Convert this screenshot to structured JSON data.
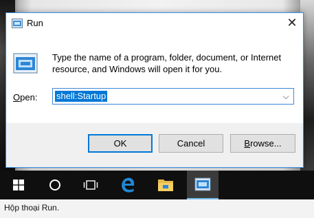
{
  "window": {
    "title": "Run",
    "close_symbol": "✕"
  },
  "dialog": {
    "description": "Type the name of a program, folder, document, or Internet resource, and Windows will open it for you.",
    "open_label_accel": "O",
    "open_label_rest": "pen:",
    "input_value": "shell:Startup",
    "dropdown_symbol": "⌵"
  },
  "buttons": {
    "ok": "OK",
    "cancel": "Cancel",
    "browse_accel": "B",
    "browse_rest": "rowse..."
  },
  "taskbar": {
    "items": [
      "windows-start-icon",
      "search-circle-icon",
      "task-view-icon",
      "edge-browser-icon",
      "file-explorer-icon",
      "run-app-icon"
    ],
    "active_color": "#76b9ed"
  },
  "caption": "Hộp thoại Run."
}
